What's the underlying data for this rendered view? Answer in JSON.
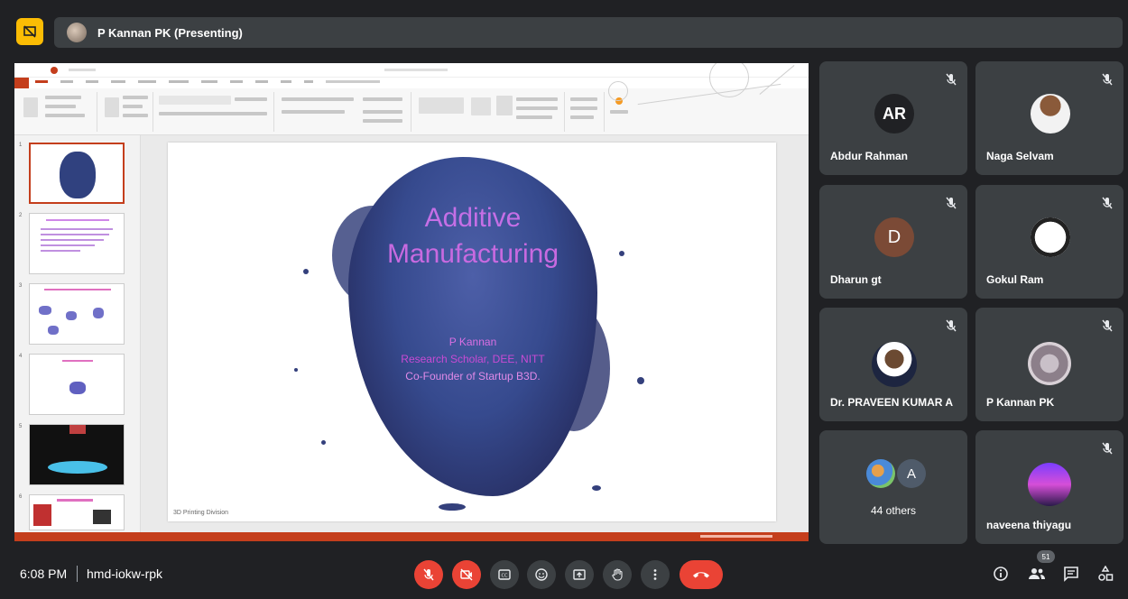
{
  "topbar": {
    "presenting_text": "P Kannan PK (Presenting)"
  },
  "slide": {
    "title_line1": "Additive",
    "title_line2": "Manufacturing",
    "presenter": "P Kannan",
    "role": "Research Scholar, DEE, NITT",
    "cofounder": "Co-Founder of Startup B3D.",
    "footer": "3D Printing Division"
  },
  "participants": [
    {
      "name": "Abdur Rahman",
      "initials": "AR",
      "muted": true
    },
    {
      "name": "Naga Selvam",
      "muted": true
    },
    {
      "name": "Dharun gt",
      "initials": "D",
      "muted": true
    },
    {
      "name": "Gokul Ram",
      "muted": true
    },
    {
      "name": "Dr. PRAVEEN KUMAR A",
      "muted": true
    },
    {
      "name": "P Kannan PK",
      "muted": true
    },
    {
      "name": "naveena thiyagu",
      "muted": true
    }
  ],
  "others": {
    "label": "44 others",
    "initial": "A"
  },
  "bottom": {
    "time": "6:08 PM",
    "meeting_code": "hmd-iokw-rpk",
    "people_count": "51"
  },
  "colors": {
    "accent": "#fbbc04",
    "danger": "#ea4335",
    "tile_bg": "#3c4043",
    "app_bg": "#202124",
    "ppt_red": "#c43e1c"
  },
  "icons": [
    "present-off-icon",
    "mic-off-icon",
    "camera-off-icon",
    "captions-icon",
    "emoji-icon",
    "present-icon",
    "raise-hand-icon",
    "more-icon",
    "hang-up-icon",
    "info-icon",
    "people-icon",
    "chat-icon",
    "activities-icon"
  ]
}
